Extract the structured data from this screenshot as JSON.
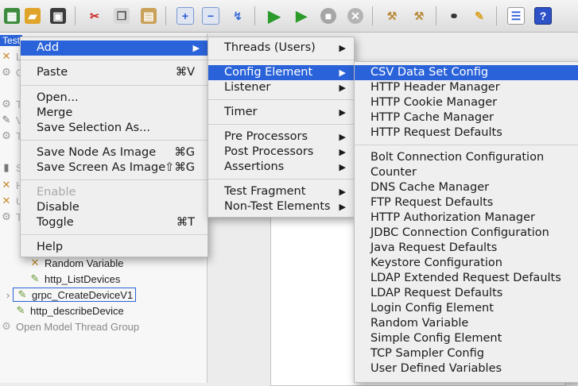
{
  "tree": {
    "root_label": "Test",
    "items": {
      "random_variable": "Random Variable",
      "http_list_devices": "http_ListDevices",
      "grpc_create_device": "grpc_CreateDeviceV1",
      "http_describe_device": "http_describeDevice",
      "open_model_thread_group": "Open Model Thread Group"
    }
  },
  "main_menu": {
    "add": "Add",
    "paste": "Paste",
    "paste_sc": "⌘V",
    "open": "Open...",
    "merge": "Merge",
    "save_selection_as": "Save Selection As...",
    "save_node_as_image": "Save Node As Image",
    "save_node_sc": "⌘G",
    "save_screen_as_image": "Save Screen As Image",
    "save_screen_sc": "⇧⌘G",
    "enable": "Enable",
    "disable": "Disable",
    "toggle": "Toggle",
    "toggle_sc": "⌘T",
    "help": "Help"
  },
  "add_menu": {
    "threads_users": "Threads (Users)",
    "config_element": "Config Element",
    "listener": "Listener",
    "timer": "Timer",
    "pre_processors": "Pre Processors",
    "post_processors": "Post Processors",
    "assertions": "Assertions",
    "test_fragment": "Test Fragment",
    "non_test_elements": "Non-Test Elements"
  },
  "config_menu": [
    "CSV Data Set Config",
    "HTTP Header Manager",
    "HTTP Cookie Manager",
    "HTTP Cache Manager",
    "HTTP Request Defaults",
    "Bolt Connection Configuration",
    "Counter",
    "DNS Cache Manager",
    "FTP Request Defaults",
    "HTTP Authorization Manager",
    "JDBC Connection Configuration",
    "Java Request Defaults",
    "Keystore Configuration",
    "LDAP Extended Request Defaults",
    "LDAP Request Defaults",
    "Login Config Element",
    "Random Variable",
    "Simple Config Element",
    "TCP Sampler Config",
    "User Defined Variables"
  ],
  "colors": {
    "highlight": "#2a63d9",
    "menu_bg": "#efefef"
  }
}
